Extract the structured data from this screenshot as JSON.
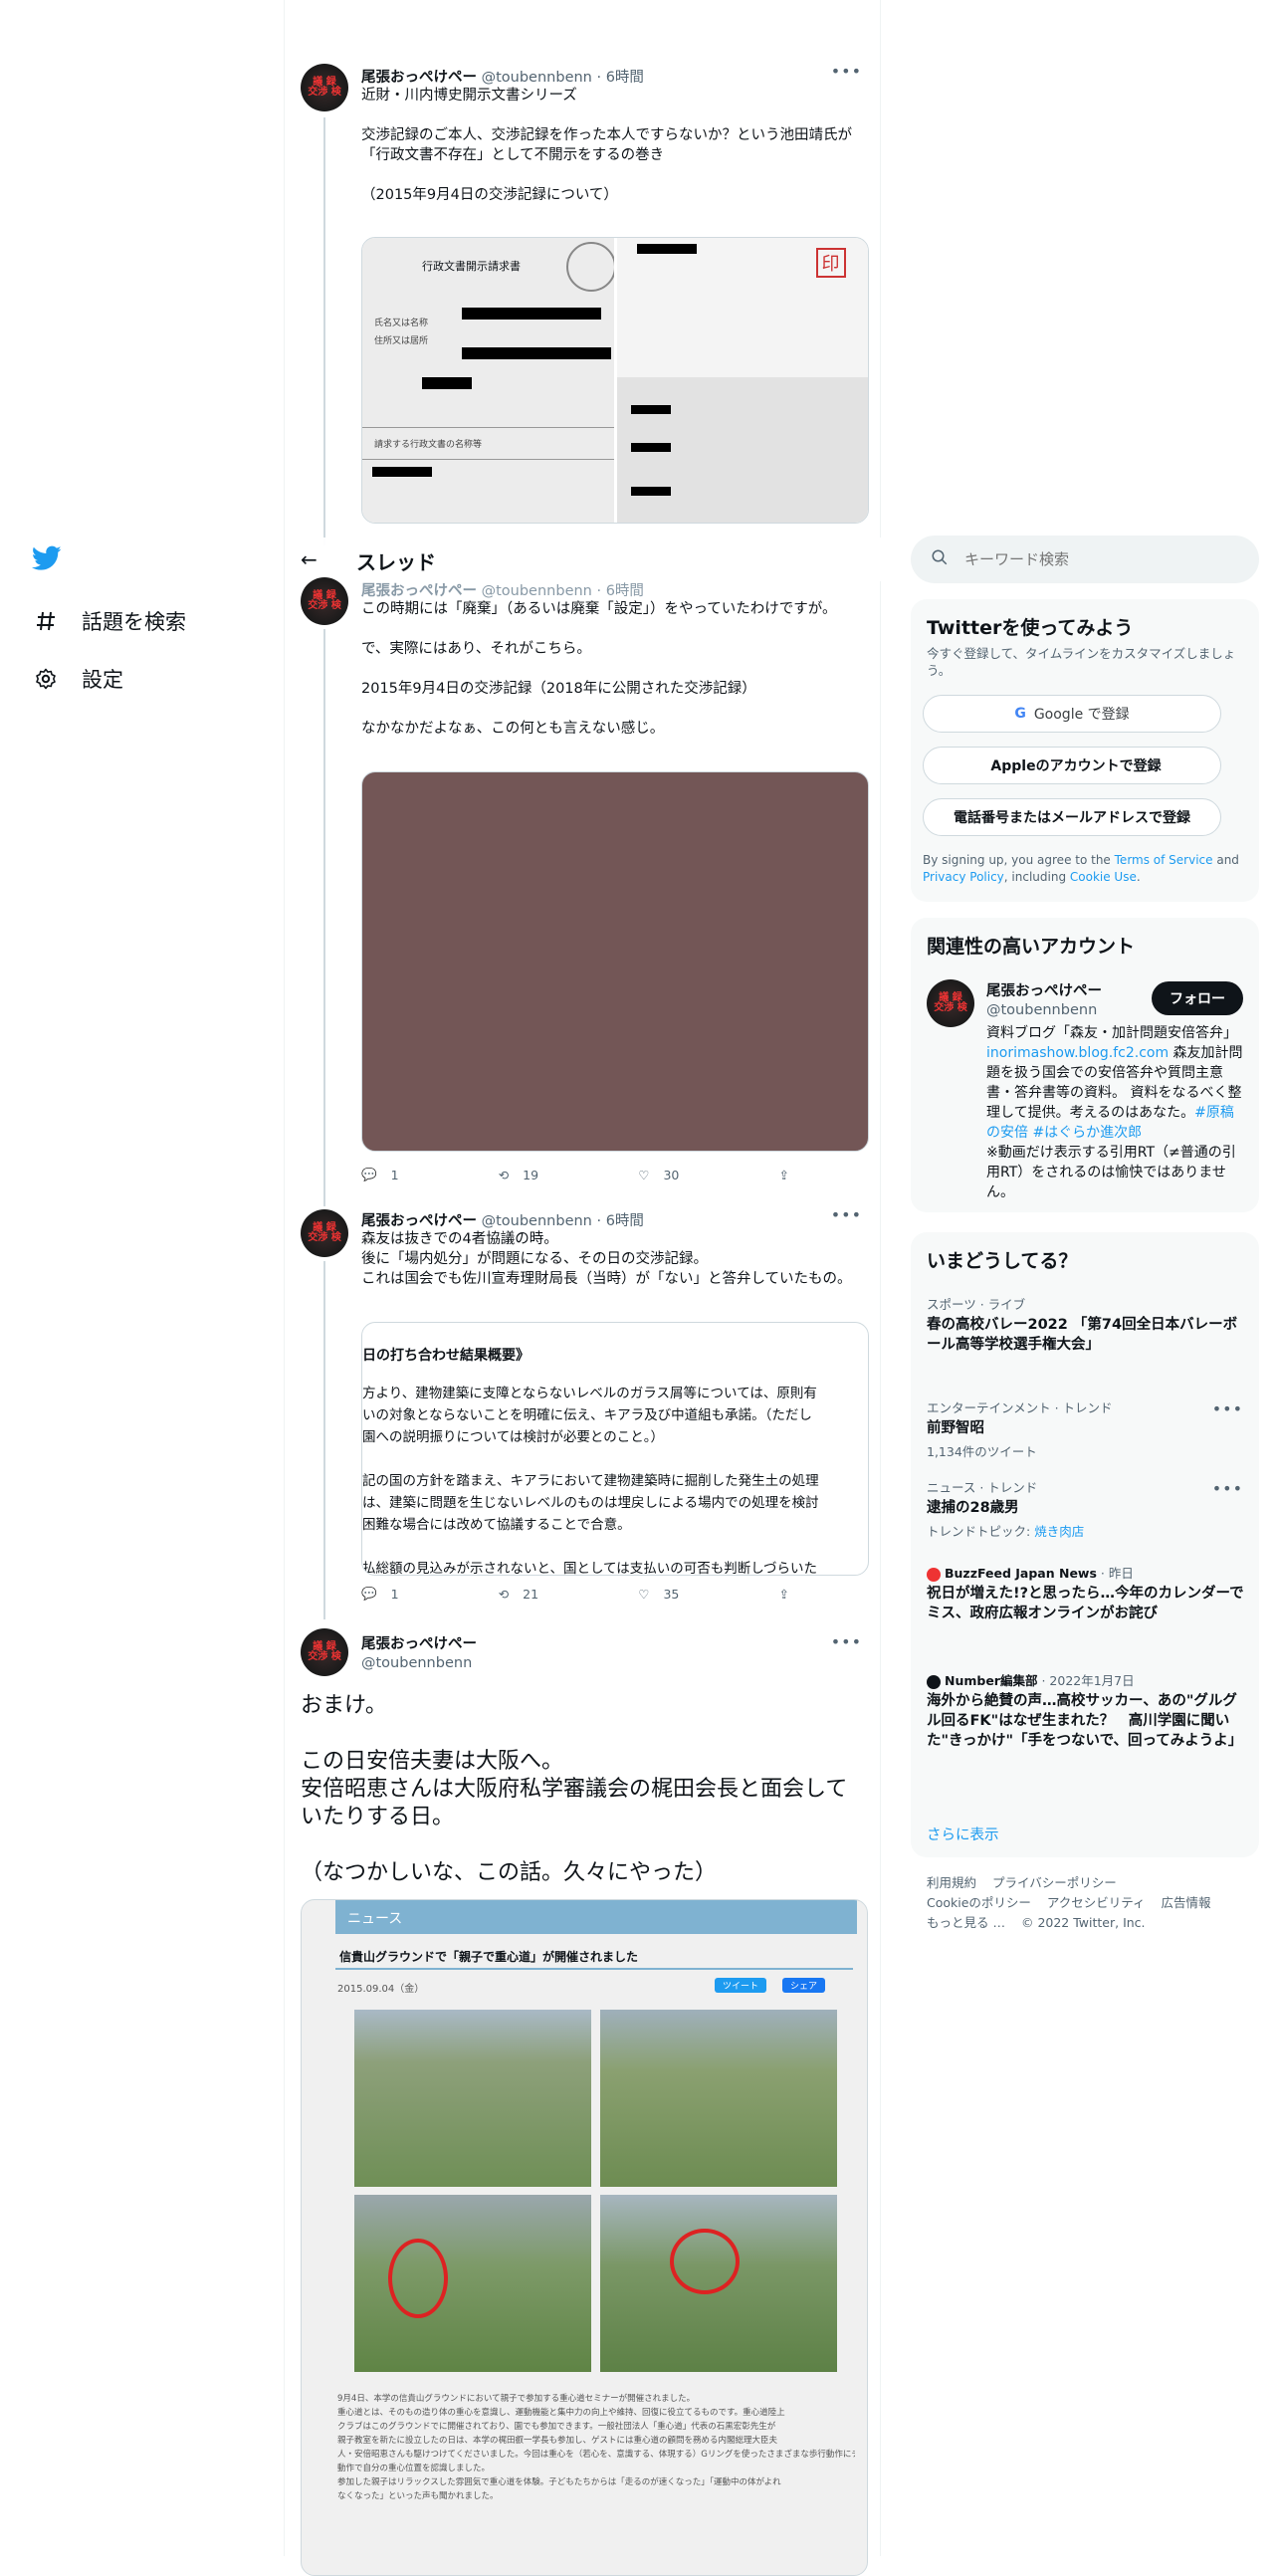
{
  "nav": {
    "explore_label": "話題を検索",
    "settings_label": "設定"
  },
  "thread_header": {
    "title": "スレッド"
  },
  "tweets": [
    {
      "name": "尾張おっぺけペー",
      "handle": "@toubennbenn",
      "time": "· 6時間",
      "text": "近財・川内博史開示文書シリーズ\n\n交渉記録のご本人、交渉記録を作った本人ですらないか？という池田靖氏が\n「行政文書不存在」として不開示をするの巻き\n\n（2015年9月4日の交渉記録について）"
    },
    {
      "name": "尾張おっぺけペー",
      "handle": "@toubennbenn",
      "time": "· 6時間",
      "text": "この時期には「廃棄」（あるいは廃棄「設定」）をやっていたわけですが。\n\nで、実際にはあり、それがこちら。\n\n2015年9月4日の交渉記録（2018年に公開された交渉記録）\n\nなかなかだよなぁ、この何とも言えない感じ。",
      "replies": "1",
      "retweets": "19",
      "likes": "30"
    },
    {
      "name": "尾張おっぺけペー",
      "handle": "@toubennbenn",
      "time": "· 6時間",
      "text": "森友は抜きでの4者協議の時。\n後に「場内処分」が問題になる、その日の交渉記録。\nこれは国会でも佐川宣寿理財局長（当時）が「ない」と答弁していたもの。",
      "replies": "1",
      "retweets": "21",
      "likes": "35"
    }
  ],
  "main_tweet": {
    "name": "尾張おっぺけペー",
    "handle": "@toubennbenn",
    "text": "おまけ。\n\nこの日安倍夫妻は大阪へ。\n安倍昭恵さんは大阪府私学審議会の梶田会長と面会していたりする日。\n\n（なつかしいな、この話。久々にやった）"
  },
  "doc_image_1": {
    "title": "行政文書開示請求書",
    "stamp": "印",
    "field_name": "氏名又は名称",
    "field_address": "住所又は居所",
    "section": "請求する行政文書の名称等"
  },
  "doc_image_2": {
    "heading": "日の打ち合わせ結果概要》",
    "lines": [
      "方より、建物建築に支障とならないレベルのガラス屑等については、原則有",
      "いの対象とならないことを明確に伝え、キアラ及び中道組も承諾。（ただし",
      "園への説明振りについては検討が必要とのこと。）",
      "",
      "記の国の方針を踏まえ、キアラにおいて建物建築時に掘削した発生土の処理",
      "は、建築に問題を生じないレベルのものは埋戻しによる場内での処理を検討",
      "困難な場合には改めて協議することで合意。",
      "",
      "払総額の見込みが示されないと、国としては支払いの可否も判断しづらいた"
    ]
  },
  "news_image": {
    "banner": "ニュース",
    "headline": "信貴山グラウンドで「親子で重心道」が開催されました",
    "date": "2015.09.04（金）",
    "tweet_btn": "ツイート",
    "share_btn": "シェア",
    "caption_lines": [
      "9月4日、本学の信貴山グラウンドにおいて親子で参加する重心道セミナーが開催されました。",
      "重心道とは、そのもの造り体の重心を意識し、運動機能と集中力の向上や維持、回復に役立てるものです。重心道陸上",
      "クラブはこのグラウンドでに開催されており、園でも参加できます。一般社団法人「重心道」代表の石黒宏彰先生が",
      "親子教室を新たに設立したの日は、本学の梶田叡一学長も参加し、ゲストには重心道の顧問を務める内閣総理大臣夫",
      "人・安倍昭恵さんも駆けつけてくださいました。今回は重心を（若心を、意識する、体現する）Gリングを使ったさまざまな歩行動作にチャレンジ。リングを回しながら円になって進んだり、リズムに合わせて歩くなど、さまざまな歩行",
      "動作で自分の重心位置を認識しました。",
      "参加した親子はリラックスした雰囲気で重心道を体験。子どもたちからは「走るのが速くなった」「運動中の体がよれ",
      "なくなった」といった声も聞かれました。"
    ]
  },
  "search": {
    "placeholder": "キーワード検索"
  },
  "signup": {
    "title": "Twitterを使ってみよう",
    "subtitle": "今すぐ登録して、タイムラインをカスタマイズしましょう。",
    "google_btn": "Google で登録",
    "apple_btn": "Appleのアカウントで登録",
    "phone_btn": "電話番号またはメールアドレスで登録",
    "legal_prefix": "By signing up, you agree to the ",
    "terms": "Terms of Service",
    "and": " and ",
    "privacy": "Privacy Policy",
    "including": ", including ",
    "cookie": "Cookie Use",
    "period": "."
  },
  "relevant": {
    "title": "関連性の高いアカウント",
    "name": "尾張おっぺけペー",
    "handle": "@toubennbenn",
    "follow_btn": "フォロー",
    "bio_1": "資料ブログ「森友・加計問題安倍答弁」 ",
    "bio_link": "inorimashow.blog.fc2.com",
    "bio_2": " 森友加計問題を扱う国会での安倍答弁や質問主意書・答弁書等の資料。 資料をなるべく整理して提供。考えるのはあなた。",
    "bio_hashtags": "#原稿の安倍 #はぐらか進次郎",
    "bio_3": "※動画だけ表示する引用RT（≠普通の引用RT）をされるのは愉快ではありません。"
  },
  "trends": {
    "title": "いまどうしてる？",
    "items": [
      {
        "meta": "スポーツ · ライブ",
        "title": "春の高校バレー2022 「第74回全日本バレーボール高等学校選手権大会」",
        "sub": ""
      },
      {
        "meta": "エンターテインメント · トレンド",
        "title": "前野智昭",
        "sub": "1,134件のツイート"
      },
      {
        "meta": "ニュース · トレンド",
        "title": "逮捕の28歳男",
        "sub_prefix": "トレンドトピック: ",
        "sub_link": "焼き肉店"
      }
    ],
    "news": [
      {
        "source": "BuzzFeed Japan News",
        "time": "· 昨日",
        "title": "祝日が増えた!?と思ったら…今年のカレンダーでミス、政府広報オンラインがお詫び"
      },
      {
        "source": "Number編集部",
        "time": "· 2022年1月7日",
        "title": "海外から絶賛の声…高校サッカー、あの\"グルグル回るFK\"はなぜ生まれた？　高川学園に聞いた\"きっかけ\"「手をつないで、回ってみようよ」"
      }
    ],
    "show_more": "さらに表示"
  },
  "footer": {
    "links": [
      "利用規約",
      "プライバシーポリシー",
      "Cookieのポリシー",
      "アクセシビリティ",
      "広告情報",
      "もっと見る …"
    ],
    "copyright": "© 2022 Twitter, Inc."
  },
  "colors": {
    "accent": "#1d9bf0",
    "text": "#0f1419",
    "muted": "#536471",
    "media_brown": "#735656"
  }
}
